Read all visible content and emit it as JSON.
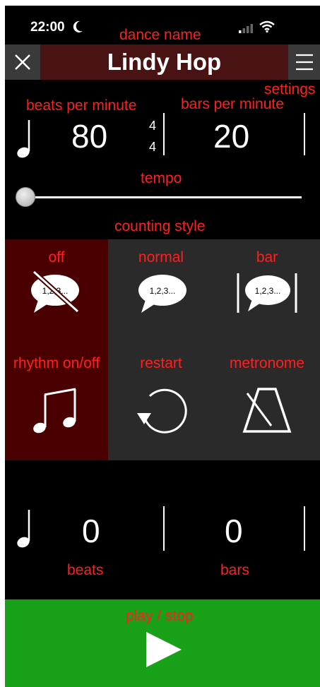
{
  "status": {
    "time": "22:00"
  },
  "annotations": {
    "dance_name": "dance name",
    "settings": "settings",
    "tempo": "tempo",
    "counting_style": "counting style",
    "play_stop": "play / stop"
  },
  "header": {
    "title": "Lindy Hop"
  },
  "tempo": {
    "bpm_label": "beats per minute",
    "bpm_value": "80",
    "time_sig_top": "4",
    "time_sig_bottom": "4",
    "bars_label": "bars per minute",
    "bars_value": "20",
    "slider_level": 0.0
  },
  "counting_buttons": [
    {
      "label": "off",
      "bubble": "1,2,3...",
      "selected": true
    },
    {
      "label": "normal",
      "bubble": "1,2,3...",
      "selected": false
    },
    {
      "label": "bar",
      "bubble": "1,2,3...",
      "selected": false
    }
  ],
  "function_buttons": [
    {
      "label": "rhythm on/off",
      "selected": true
    },
    {
      "label": "restart",
      "selected": false
    },
    {
      "label": "metronome",
      "selected": false
    }
  ],
  "counters": {
    "beats_value": "0",
    "beats_label": "beats",
    "bars_value": "0",
    "bars_label": "bars"
  },
  "colors": {
    "selected_bg": "#4a0000",
    "button_bg": "#2a2a2a",
    "play_bg": "#19a019",
    "title_bg": "#4a1313",
    "annotation": "#ff1f1f"
  }
}
